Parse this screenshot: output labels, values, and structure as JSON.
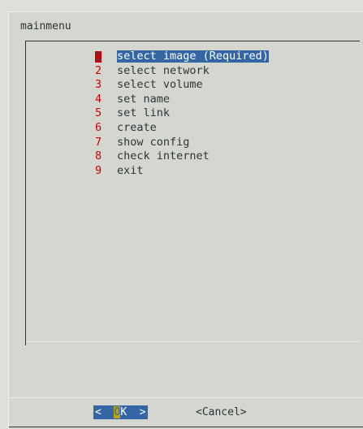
{
  "dialog": {
    "title": "mainmenu"
  },
  "menu": {
    "items": [
      {
        "key": "1",
        "label": "select image (Required)",
        "selected": true
      },
      {
        "key": "2",
        "label": "select network",
        "selected": false
      },
      {
        "key": "3",
        "label": "select volume",
        "selected": false
      },
      {
        "key": "4",
        "label": "set name",
        "selected": false
      },
      {
        "key": "5",
        "label": "set link",
        "selected": false
      },
      {
        "key": "6",
        "label": "create",
        "selected": false
      },
      {
        "key": "7",
        "label": "show config",
        "selected": false
      },
      {
        "key": "8",
        "label": "check internet",
        "selected": false
      },
      {
        "key": "9",
        "label": "exit",
        "selected": false
      }
    ]
  },
  "buttons": {
    "ok": {
      "left_bracket": "<",
      "hotkey": "O",
      "rest": "K",
      "right_bracket": ">"
    },
    "cancel": {
      "label": "<Cancel>"
    }
  },
  "colors": {
    "background": "#d3d7cf",
    "selection": "#3465a4",
    "hotkey_number": "#cc0000",
    "ok_hotkey": "#fce94f"
  }
}
